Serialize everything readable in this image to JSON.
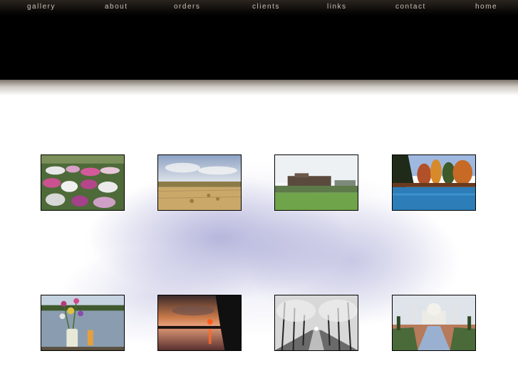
{
  "nav": {
    "gallery": "gallery",
    "about": "about",
    "orders": "orders",
    "clients": "clients",
    "links": "links",
    "contact": "contact",
    "home": "home"
  },
  "colors": {
    "nav_text": "#c9c2b6",
    "header_bg": "#000000",
    "cloud": "#8c8cc8"
  },
  "thumbnails": [
    {
      "name": "flower-garden-photo"
    },
    {
      "name": "hay-field-photo"
    },
    {
      "name": "building-landscape-photo"
    },
    {
      "name": "autumn-river-photo"
    },
    {
      "name": "flower-vase-lake-photo"
    },
    {
      "name": "sunset-lake-photo"
    },
    {
      "name": "snowy-tree-lane-photo"
    },
    {
      "name": "taj-mahal-photo"
    }
  ]
}
